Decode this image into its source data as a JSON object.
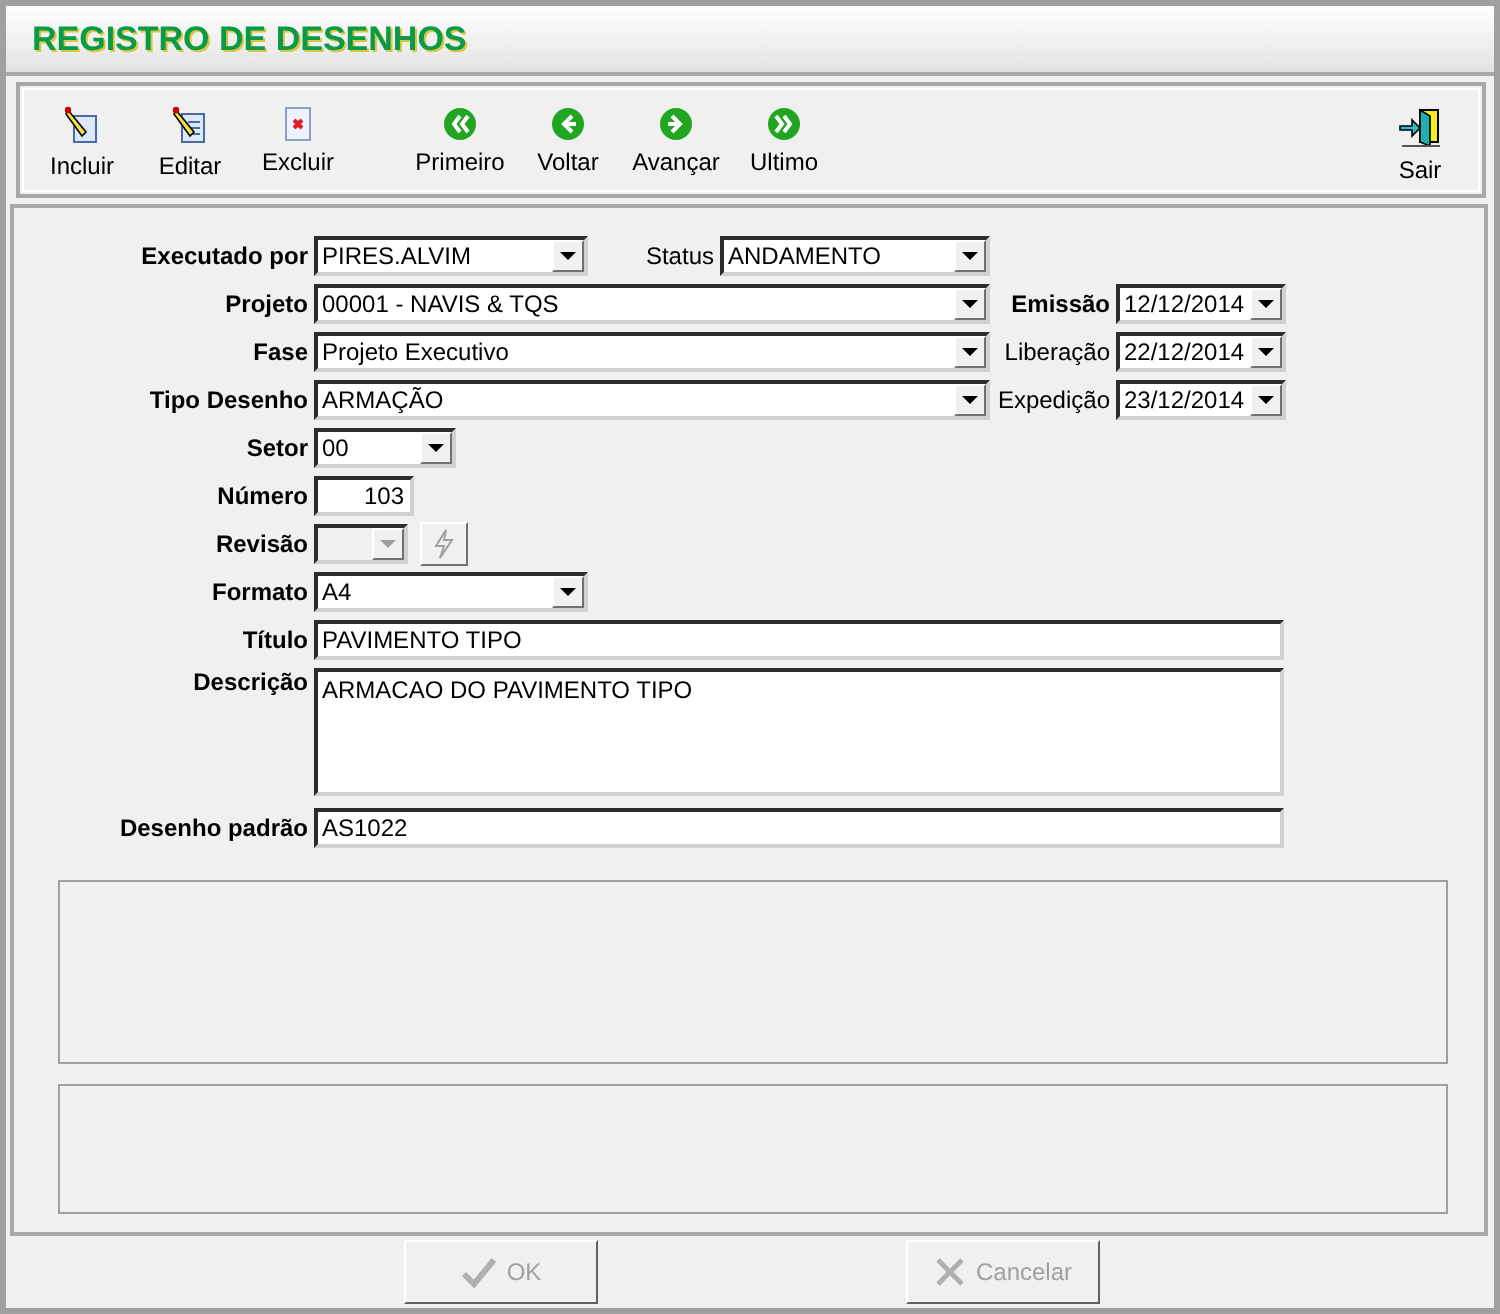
{
  "title": "REGISTRO DE DESENHOS",
  "toolbar": {
    "actions": [
      {
        "label": "Incluir"
      },
      {
        "label": "Editar"
      },
      {
        "label": "Excluir"
      }
    ],
    "navigation": [
      {
        "label": "Primeiro"
      },
      {
        "label": "Voltar"
      },
      {
        "label": "Avançar"
      },
      {
        "label": "Ultimo"
      }
    ],
    "exit": {
      "label": "Sair"
    }
  },
  "form": {
    "executado_por": {
      "label": "Executado por",
      "value": "PIRES.ALVIM"
    },
    "status": {
      "label": "Status",
      "value": "ANDAMENTO"
    },
    "projeto": {
      "label": "Projeto",
      "value": "00001 - NAVIS & TQS"
    },
    "emissao": {
      "label": "Emissão",
      "value": "12/12/2014"
    },
    "fase": {
      "label": "Fase",
      "value": "Projeto Executivo"
    },
    "liberacao": {
      "label": "Liberação",
      "value": "22/12/2014"
    },
    "tipo_desenho": {
      "label": "Tipo Desenho",
      "value": "ARMAÇÃO"
    },
    "expedicao": {
      "label": "Expedição",
      "value": "23/12/2014"
    },
    "setor": {
      "label": "Setor",
      "value": "00"
    },
    "numero": {
      "label": "Número",
      "value": "103"
    },
    "revisao": {
      "label": "Revisão",
      "disabled": true
    },
    "formato": {
      "label": "Formato",
      "value": "A4"
    },
    "titulo": {
      "label": "Título",
      "value": "PAVIMENTO TIPO"
    },
    "descricao": {
      "label": "Descrição",
      "value": "ARMACAO DO PAVIMENTO TIPO"
    },
    "desenho_padrao": {
      "label": "Desenho padrão",
      "value": "AS1022"
    }
  },
  "buttons": [
    {
      "label": "OK",
      "kind": "ok",
      "disabled": true
    },
    {
      "label": "Cancelar",
      "kind": "cancel",
      "disabled": true
    }
  ]
}
